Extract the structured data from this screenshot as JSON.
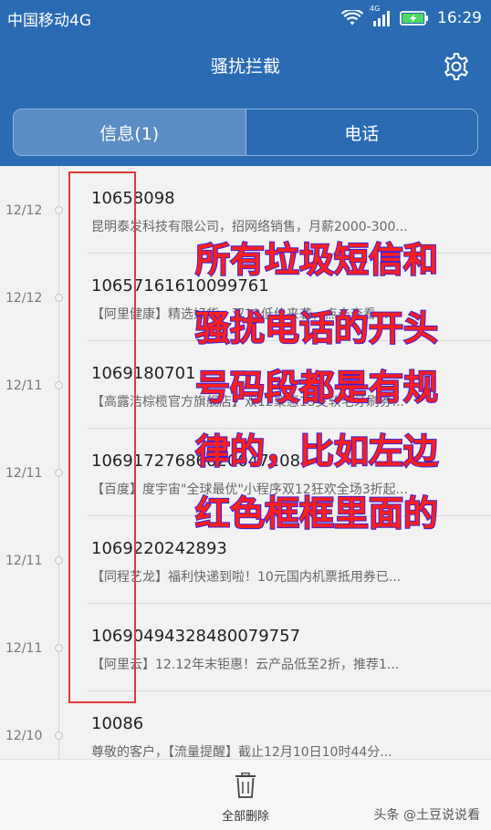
{
  "status": {
    "carrier": "中国移动4G",
    "network": "4G",
    "time": "16:29"
  },
  "header": {
    "title": "骚扰拦截"
  },
  "tabs": [
    {
      "label": "信息(1)",
      "active": true
    },
    {
      "label": "电话",
      "active": false
    }
  ],
  "messages": [
    {
      "date": "12/12",
      "number": "10658098",
      "preview": "昆明泰发科技有限公司，招网络销售，月薪2000-300..."
    },
    {
      "date": "12/12",
      "number": "10657161610099761",
      "preview": "【阿里健康】精选好货，双12低价来袭，点击查看..."
    },
    {
      "date": "12/11",
      "number": "1069180701",
      "preview": "【高露洁棕榄官方旗舰店】双12聚惠15支软毛牙刷券..."
    },
    {
      "date": "12/11",
      "number": "10691727686020047108",
      "preview": "【百度】度宇宙\"全球最优\"小程序双12狂欢全场3折起..."
    },
    {
      "date": "12/11",
      "number": "1069220242893",
      "preview": "【同程艺龙】福利快递到啦！10元国内机票抵用券已..."
    },
    {
      "date": "12/11",
      "number": "10690494328480079757",
      "preview": "【阿里云】12.12年末钜惠！云产品低至2折，推荐1..."
    },
    {
      "date": "12/10",
      "number": "10086",
      "preview": "尊敬的客户，【流量提醒】截止12月10日10时44分..."
    }
  ],
  "annotation": {
    "lines": [
      "所有垃圾短信和",
      "骚扰电话的开头",
      "号码段都是有规",
      "律的，比如左边",
      "红色框框里面的"
    ]
  },
  "footer": {
    "delete_all": "全部删除",
    "watermark": "头条 @土豆说说看"
  },
  "colors": {
    "primary": "#2a6bb3",
    "overlay_text": "#ff1e1e",
    "overlay_outline": "#3a1fd8",
    "highlight_box": "#e03a3a"
  }
}
